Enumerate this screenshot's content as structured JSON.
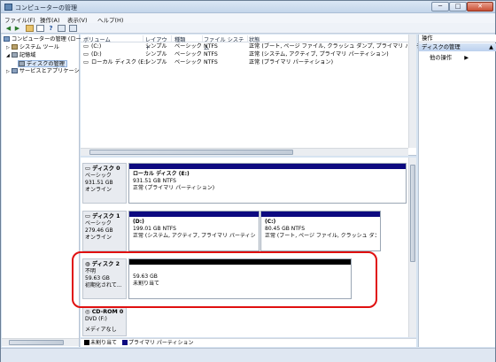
{
  "window": {
    "title": "コンピューターの管理",
    "min": "─",
    "max": "□",
    "close": "✕"
  },
  "menu": [
    "ファイル(F)",
    "操作(A)",
    "表示(V)",
    "ヘルプ(H)"
  ],
  "tree": {
    "root": "コンピューターの管理 (ロー",
    "items": [
      "システム ツール",
      "記憶域",
      "ディスクの管理",
      "サービスとアプリケーショ"
    ]
  },
  "volume_list": {
    "headers": [
      "ボリューム",
      "レイアウト",
      "種類",
      "ファイル システム",
      "状態"
    ],
    "rows": [
      [
        "(C:)",
        "シンプル",
        "ベーシック",
        "NTFS",
        "正常 (ブート, ページ ファイル, クラッシュ ダンプ, プライマリ パーティショ"
      ],
      [
        "(D:)",
        "シンプル",
        "ベーシック",
        "NTFS",
        "正常 (システム, アクティブ, プライマリ パーティション)"
      ],
      [
        "ローカル ディスク (E:)",
        "シンプル",
        "ベーシック",
        "NTFS",
        "正常 (プライマリ パーティション)"
      ]
    ]
  },
  "disks": [
    {
      "name": "ディスク 0",
      "type": "ベーシック",
      "size": "931.51 GB",
      "status": "オンライン",
      "partitions": [
        {
          "title": "ローカル ディスク (E:)",
          "size": "931.51 GB NTFS",
          "status": "正常 (プライマリ パーティション)"
        }
      ]
    },
    {
      "name": "ディスク 1",
      "type": "ベーシック",
      "size": "279.46 GB",
      "status": "オンライン",
      "partitions": [
        {
          "title": "(D:)",
          "size": "199.01 GB NTFS",
          "status": "正常 (システム, アクティブ, プライマリ パーティション)"
        },
        {
          "title": "(C:)",
          "size": "80.45 GB NTFS",
          "status": "正常 (ブート, ページ ファイル, クラッシュ ダンプ, プ"
        }
      ]
    },
    {
      "name": "ディスク 2",
      "type": "不明",
      "size": "59.63 GB",
      "status": "初期化されて...",
      "partitions": [
        {
          "title": "",
          "size": "59.63 GB",
          "status": "未割り当て"
        }
      ]
    },
    {
      "name": "CD-ROM 0",
      "type": "DVD (F:)",
      "size": "",
      "status": "メディアなし",
      "partitions": []
    }
  ],
  "legend": [
    {
      "label": "未割り当て",
      "color": "#000000"
    },
    {
      "label": "プライマリ パーティション",
      "color": "#0d0a80"
    }
  ],
  "actions": {
    "header": "操作",
    "section": "ディスクの管理",
    "item": "他の操作"
  },
  "colors": {
    "primary_partition": "#0d0a80",
    "unallocated": "#000000",
    "highlight": "#e01010"
  }
}
